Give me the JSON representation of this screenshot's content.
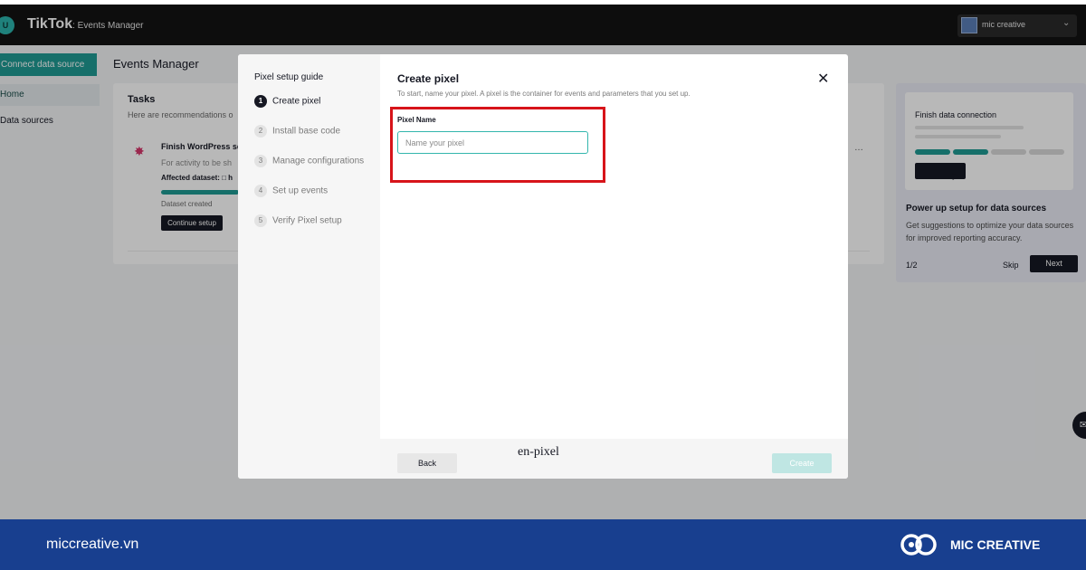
{
  "app": {
    "brand": "TikTok",
    "brand_sub": ": Events Manager",
    "logo_letter": "U",
    "account_name": "mic creative"
  },
  "sidebar": {
    "connect_label": "Connect data source",
    "items": [
      {
        "label": "Home"
      },
      {
        "label": "Data sources"
      }
    ]
  },
  "page": {
    "title": "Events Manager"
  },
  "tasks": {
    "title": "Tasks",
    "description": "Here are recommendations o",
    "item": {
      "name": "Finish WordPress se",
      "subtitle": "For activity to be sh",
      "affected": "Affected dataset: □ h",
      "progress_percent": 55,
      "status": "Dataset created",
      "action": "Continue setup",
      "more": "…"
    }
  },
  "promo": {
    "inner_title": "Finish data connection",
    "title": "Power up setup for data sources",
    "description": "Get suggestions to optimize your data sources for improved reporting accuracy.",
    "page": "1/2",
    "skip": "Skip",
    "next": "Next",
    "segment_colors": [
      "#1f9a94",
      "#1f9a94",
      "#d8d8d8",
      "#d8d8d8"
    ]
  },
  "modal": {
    "guide_title": "Pixel setup guide",
    "steps": [
      {
        "num": "1",
        "label": "Create pixel",
        "active": true
      },
      {
        "num": "2",
        "label": "Install base code",
        "active": false
      },
      {
        "num": "3",
        "label": "Manage configurations",
        "active": false
      },
      {
        "num": "4",
        "label": "Set up events",
        "active": false
      },
      {
        "num": "5",
        "label": "Verify Pixel setup",
        "active": false
      }
    ],
    "title": "Create pixel",
    "description": "To start, name your pixel. A pixel is the container for events and parameters that you set up.",
    "field_label": "Pixel Name",
    "field_placeholder": "Name your pixel",
    "field_value": "",
    "close": "✕",
    "back": "Back",
    "create": "Create"
  },
  "caption": "en-pixel",
  "banner": {
    "url": "miccreative.vn",
    "brand": "MIC CREATIVE"
  },
  "colors": {
    "accent": "#1f9a94",
    "highlight": "#d7141a",
    "banner": "#183f8f"
  }
}
